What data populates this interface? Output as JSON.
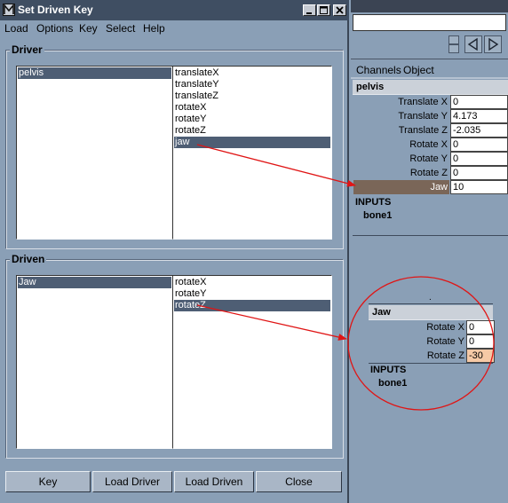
{
  "window": {
    "title": "Set Driven Key",
    "menus": [
      "Load",
      "Options",
      "Key",
      "Select",
      "Help"
    ]
  },
  "driver": {
    "group_label": "Driver",
    "objects": [
      {
        "label": "pelvis",
        "selected": true
      }
    ],
    "attributes": [
      {
        "label": "translateX",
        "selected": false
      },
      {
        "label": "translateY",
        "selected": false
      },
      {
        "label": "translateZ",
        "selected": false
      },
      {
        "label": "rotateX",
        "selected": false
      },
      {
        "label": "rotateY",
        "selected": false
      },
      {
        "label": "rotateZ",
        "selected": false
      },
      {
        "label": "jaw",
        "selected": true
      }
    ]
  },
  "driven": {
    "group_label": "Driven",
    "objects": [
      {
        "label": "Jaw",
        "selected": true
      }
    ],
    "attributes": [
      {
        "label": "rotateX",
        "selected": false
      },
      {
        "label": "rotateY",
        "selected": false
      },
      {
        "label": "rotateZ",
        "selected": true
      }
    ]
  },
  "buttons": {
    "key": "Key",
    "load_driver": "Load Driver",
    "load_driven": "Load Driven",
    "close": "Close"
  },
  "channel_box": {
    "menus": {
      "channels": "Channels",
      "object": "Object"
    },
    "pelvis": {
      "node": "pelvis",
      "attrs": [
        {
          "label": "Translate X",
          "value": "0"
        },
        {
          "label": "Translate Y",
          "value": "4.173"
        },
        {
          "label": "Translate Z",
          "value": "-2.035"
        },
        {
          "label": "Rotate X",
          "value": "0"
        },
        {
          "label": "Rotate Y",
          "value": "0"
        },
        {
          "label": "Rotate Z",
          "value": "0"
        },
        {
          "label": "Jaw",
          "value": "10",
          "highlighted": true
        }
      ],
      "inputs_label": "INPUTS",
      "inputs_node": "bone1"
    },
    "jaw_callout": {
      "node": "Jaw",
      "attrs": [
        {
          "label": "Rotate X",
          "value": "0"
        },
        {
          "label": "Rotate Y",
          "value": "0"
        },
        {
          "label": "Rotate Z",
          "value": "-30",
          "highlighted": true
        }
      ],
      "inputs_label": "INPUTS",
      "inputs_node": "bone1"
    }
  },
  "icons": {
    "app": "maya-logo-icon",
    "minimize": "minimize-icon",
    "maximize": "maximize-icon",
    "close": "close-icon",
    "prev": "triangle-left-icon",
    "next": "triangle-right-icon"
  },
  "colors": {
    "background": "#8a9fb6",
    "selection": "#4e5e74",
    "titlebar": "#3f4e62",
    "annotation": "#e01515",
    "highlight_driver": "#7a6658",
    "highlight_driven": "#f6c9a6"
  }
}
